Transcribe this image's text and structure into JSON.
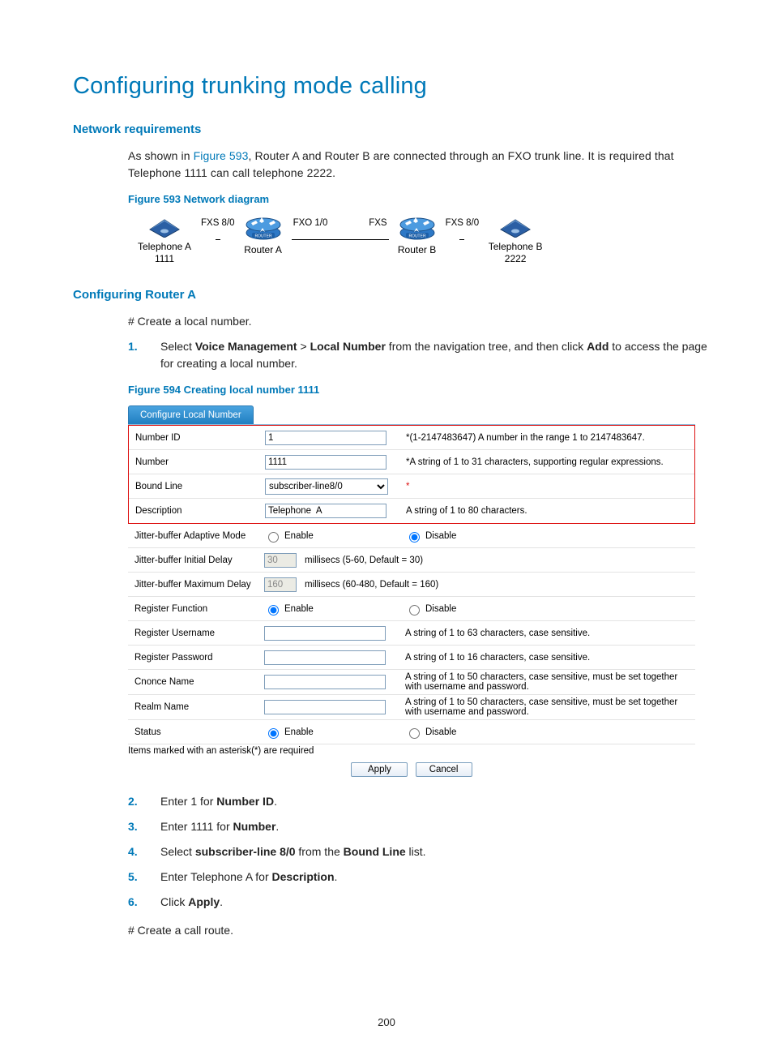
{
  "title": "Configuring trunking mode calling",
  "sections": {
    "net_req": "Network requirements",
    "cfg_a": "Configuring Router A"
  },
  "intro_1": "As shown in ",
  "intro_link": "Figure 593",
  "intro_2": ", Router A and Router B are connected through an FXO trunk line. It is required that Telephone 1111 can call telephone 2222.",
  "fig593_caption": "Figure 593 Network diagram",
  "diagram": {
    "phone_a": "Telephone A",
    "phone_a_num": "1111",
    "phone_b": "Telephone B",
    "phone_b_num": "2222",
    "router_a": "Router A",
    "router_b": "Router B",
    "port_fxs80_a": "FXS 8/0",
    "port_fxo10": "FXO  1/0",
    "port_fxs_b": "FXS",
    "port_fxs80_b": "FXS 8/0",
    "router_badge": "ROUTER"
  },
  "hash_create_local": "# Create a local number.",
  "step1": {
    "n": "1.",
    "pre": "Select ",
    "b1": "Voice Management",
    "gt": " > ",
    "b2": "Local Number",
    "mid": " from the navigation tree, and then click ",
    "b3": "Add",
    "post": " to access the page for creating a local number."
  },
  "fig594_caption": "Figure 594 Creating local number 1111",
  "form": {
    "tab": "Configure Local Number",
    "rows": {
      "number_id": {
        "label": "Number ID",
        "value": "1",
        "help": "*(1-2147483647) A number in the range 1 to 2147483647."
      },
      "number": {
        "label": "Number",
        "value": "1111",
        "help": "*A string of 1 to 31 characters, supporting regular expressions."
      },
      "bound": {
        "label": "Bound Line",
        "value": "subscriber-line8/0",
        "help": "*"
      },
      "desc": {
        "label": "Description",
        "value": "Telephone  A",
        "help": "A string of 1 to 80 characters."
      },
      "jb_mode": {
        "label": "Jitter-buffer Adaptive Mode",
        "enable": "Enable",
        "disable": "Disable"
      },
      "jb_init": {
        "label": "Jitter-buffer Initial Delay",
        "value": "30",
        "help": "millisecs (5-60, Default = 30)"
      },
      "jb_max": {
        "label": "Jitter-buffer Maximum Delay",
        "value": "160",
        "help": "millisecs (60-480, Default = 160)"
      },
      "reg_fn": {
        "label": "Register Function",
        "enable": "Enable",
        "disable": "Disable"
      },
      "reg_user": {
        "label": "Register Username",
        "value": "",
        "help": "A string of 1 to 63 characters, case sensitive."
      },
      "reg_pass": {
        "label": "Register Password",
        "value": "",
        "help": "A string of 1 to 16 characters, case sensitive."
      },
      "cnonce": {
        "label": "Cnonce Name",
        "value": "",
        "help": "A string of 1 to 50 characters, case sensitive, must be set together with username and password."
      },
      "realm": {
        "label": "Realm Name",
        "value": "",
        "help": "A string of 1 to 50 characters, case sensitive, must be set together with username and password."
      },
      "status": {
        "label": "Status",
        "enable": "Enable",
        "disable": "Disable"
      }
    },
    "note": "Items marked with an asterisk(*) are required",
    "apply": "Apply",
    "cancel": "Cancel"
  },
  "steps_b": [
    {
      "n": "2.",
      "pre": "Enter 1 for ",
      "b": "Number ID",
      "post": "."
    },
    {
      "n": "3.",
      "pre": "Enter 1111 for ",
      "b": "Number",
      "post": "."
    },
    {
      "n": "4.",
      "pre": "Select ",
      "b": "subscriber-line 8/0",
      "mid": " from the ",
      "b2": "Bound Line",
      "post": " list."
    },
    {
      "n": "5.",
      "pre": "Enter Telephone A for ",
      "b": "Description",
      "post": "."
    },
    {
      "n": "6.",
      "pre": "Click ",
      "b": "Apply",
      "post": "."
    }
  ],
  "hash_call_route": "# Create a call route.",
  "pagenum": "200"
}
